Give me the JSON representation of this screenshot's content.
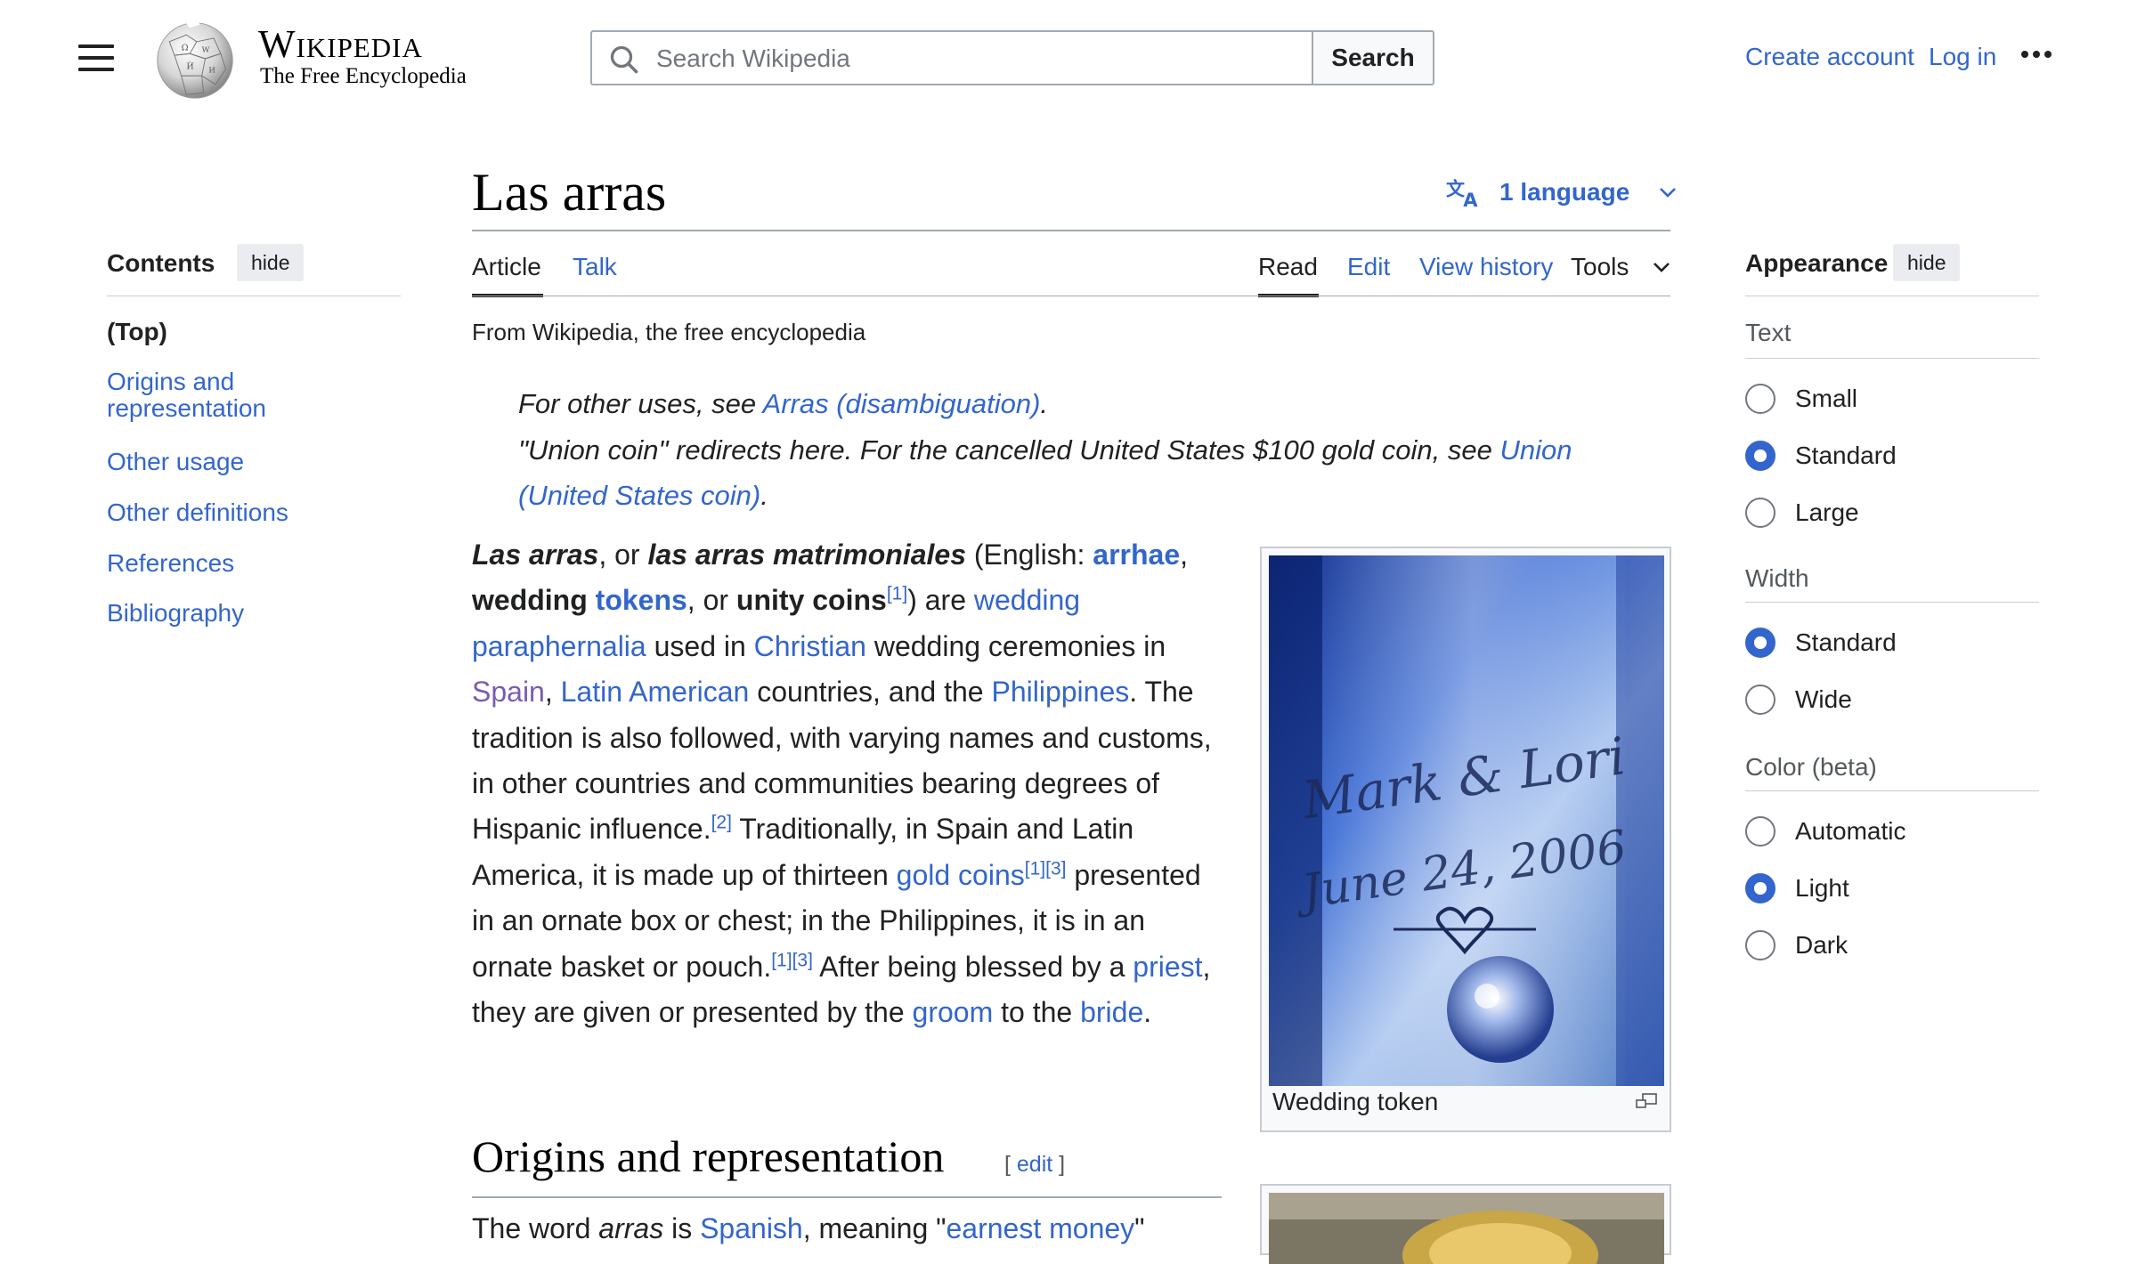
{
  "header": {
    "wordmark": "Wikipedia",
    "tagline": "The Free Encyclopedia",
    "search_placeholder": "Search Wikipedia",
    "search_button": "Search",
    "create_account": "Create account",
    "log_in": "Log in",
    "menu_icon": "hamburger-icon",
    "more_icon": "ellipsis-icon"
  },
  "toc": {
    "title": "Contents",
    "hide_label": "hide",
    "items": [
      {
        "label": "(Top)"
      },
      {
        "label": "Origins and representation"
      },
      {
        "label": "Other usage"
      },
      {
        "label": "Other definitions"
      },
      {
        "label": "References"
      },
      {
        "label": "Bibliography"
      }
    ]
  },
  "page": {
    "title": "Las arras",
    "language_label": "1 language",
    "tabs_left": [
      "Article",
      "Talk"
    ],
    "tabs_right": [
      "Read",
      "Edit",
      "View history"
    ],
    "tools_label": "Tools",
    "from_wikipedia": "From Wikipedia, the free encyclopedia",
    "hatnote1": {
      "pre": "For other uses, see ",
      "link": "Arras (disambiguation)",
      "post": "."
    },
    "hatnote2": {
      "pre": "\"Union coin\" redirects here. For the cancelled United States $100 gold coin, see ",
      "link": "Union (United States coin)",
      "post": "."
    },
    "section_heading": "Origins and representation",
    "edit_label": "edit",
    "section_text_pre": "The word ",
    "section_text_em": "arras",
    "section_text_mid": " is ",
    "section_text_link1": "Spanish",
    "section_text_mid2": ", meaning \"",
    "section_text_link2": "earnest money",
    "section_text_post": "\""
  },
  "intro": {
    "t1": "Las arras",
    "t2": ", or ",
    "t3": "las arras matrimoniales",
    "t4": " (English: ",
    "l_arrhae": "arrhae",
    "t5": ", ",
    "t6": "wedding ",
    "l_tokens": "tokens",
    "t7": ", or ",
    "t8": "unity coins",
    "ref1": "[1]",
    "t9": ") are ",
    "l_paraphernalia": "wedding paraphernalia",
    "t10": " used in ",
    "l_christian": "Christian",
    "t11": " wedding ceremonies in ",
    "l_spain": "Spain",
    "t12": ", ",
    "l_latam": "Latin American",
    "t13": " countries, and the ",
    "l_phil": "Philippines",
    "t14": ". The tradition is also followed, with varying names and customs, in other countries and communities bearing degrees of Hispanic influence.",
    "ref2": "[2]",
    "t15": " Traditionally, in Spain and Latin America, it is made up of thirteen ",
    "l_gold": "gold coins",
    "ref1b": "[1]",
    "ref3": "[3]",
    "t16": " presented in an ornate box or chest; in the Philippines, it is in an ornate basket or pouch.",
    "ref1c": "[1]",
    "ref3b": "[3]",
    "t17": " After being blessed by a ",
    "l_priest": "priest",
    "t18": ", they are given or presented by the ",
    "l_groom": "groom",
    "t19": " to the ",
    "l_bride": "bride",
    "t20": "."
  },
  "figure": {
    "engraving_line1": "Mark & Lori",
    "engraving_line2": "June 24, 2006",
    "caption": "Wedding token"
  },
  "appearance": {
    "title": "Appearance",
    "hide_label": "hide",
    "text_label": "Text",
    "text_options": [
      "Small",
      "Standard",
      "Large"
    ],
    "text_selected": "Standard",
    "width_label": "Width",
    "width_options": [
      "Standard",
      "Wide"
    ],
    "width_selected": "Standard",
    "color_label": "Color (beta)",
    "color_options": [
      "Automatic",
      "Light",
      "Dark"
    ],
    "color_selected": "Light"
  },
  "colors": {
    "link": "#3366cc",
    "visited_link": "#795cb2",
    "text": "#202122",
    "border": "#a2a9b1"
  }
}
